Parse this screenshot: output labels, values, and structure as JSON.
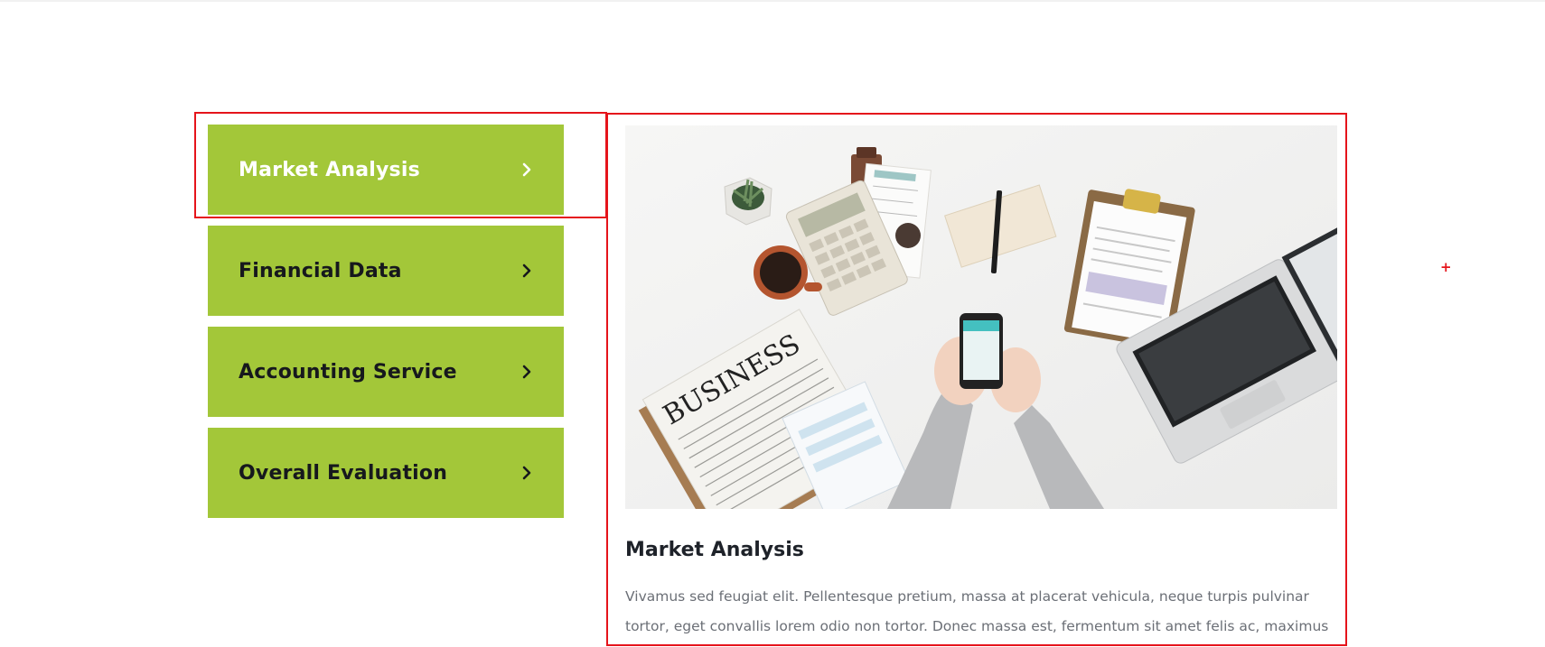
{
  "tabs": [
    {
      "label": "Market Analysis",
      "active": true
    },
    {
      "label": "Financial Data",
      "active": false
    },
    {
      "label": "Accounting Service",
      "active": false
    },
    {
      "label": "Overall Evaluation",
      "active": false
    }
  ],
  "panel": {
    "title": "Market Analysis",
    "text": "Vivamus sed feugiat elit. Pellentesque pretium, massa at placerat vehicula, neque turpis pulvinar tortor, eget convallis lorem odio non tortor. Donec massa est, fermentum sit amet felis ac, maximus",
    "image": {
      "newspaper_headline": "BUSINESS"
    }
  },
  "marker": {
    "symbol": "+"
  },
  "colors": {
    "accent": "#a3c739",
    "focus_outline": "#e5141b",
    "heading": "#1e2229",
    "body_text": "#6b6f76"
  },
  "icons": {
    "tab_arrow": "chevron-right-icon"
  }
}
